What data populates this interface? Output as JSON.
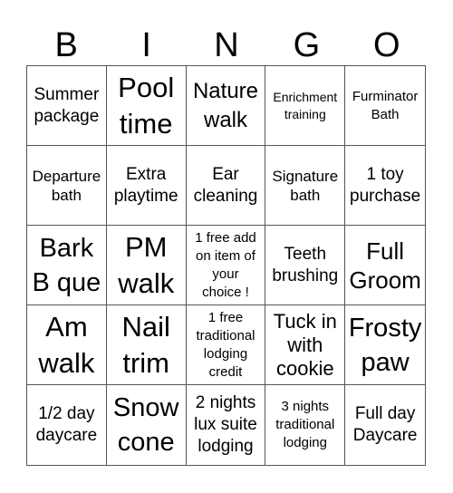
{
  "header": {
    "letters": [
      "B",
      "I",
      "N",
      "G",
      "O"
    ]
  },
  "cells": [
    "Summer\npackage",
    "Pool\ntime",
    "Nature\nwalk",
    "Enrichment\ntraining",
    "Furminator\nBath",
    "Departure\nbath",
    "Extra\nplaytime",
    "Ear\ncleaning",
    "Signature\nbath",
    "1 toy\npurchase",
    "Bark\nB que",
    "PM\nwalk",
    "1 free add\non item of\nyour\nchoice !",
    "Teeth\nbrushing",
    "Full\nGroom",
    "Am\nwalk",
    "Nail\ntrim",
    "1 free\ntraditional\nlodging\ncredit",
    "Tuck in\nwith\ncookie",
    "Frosty\npaw",
    "1/2 day\ndaycare",
    "Snow\ncone",
    "2 nights\nlux suite\nlodging",
    "3 nights\ntraditional\nlodging",
    "Full day\nDaycare"
  ]
}
